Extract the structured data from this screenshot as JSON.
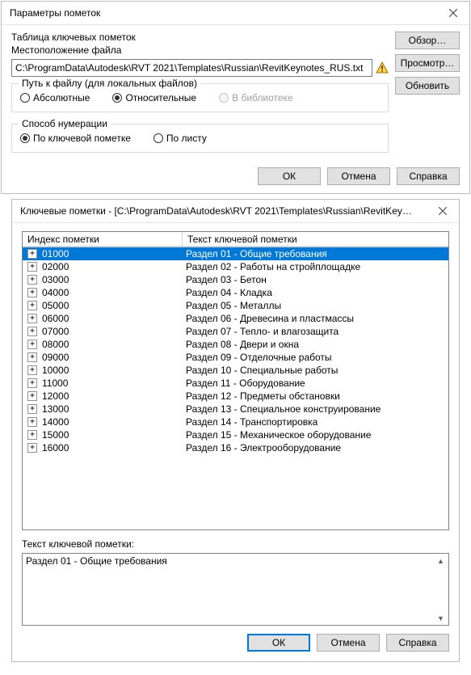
{
  "dialog1": {
    "title": "Параметры пометок",
    "table_label": "Таблица ключевых пометок",
    "file_loc_label": "Местоположение файла",
    "file_path": "C:\\ProgramData\\Autodesk\\RVT 2021\\Templates\\Russian\\RevitKeynotes_RUS.txt",
    "btn_browse": "Обзор…",
    "btn_view": "Просмотр…",
    "btn_update": "Обновить",
    "path_group_label": "Путь к файлу (для локальных файлов)",
    "radio_absolute": "Абсолютные",
    "radio_relative": "Относительные",
    "radio_library": "В библиотеке",
    "numbering_label": "Способ нумерации",
    "radio_by_key": "По ключевой пометке",
    "radio_by_sheet": "По листу",
    "btn_ok": "ОК",
    "btn_cancel": "Отмена",
    "btn_help": "Справка"
  },
  "dialog2": {
    "title": "Ключевые пометки - [C:\\ProgramData\\Autodesk\\RVT 2021\\Templates\\Russian\\RevitKeynote…",
    "col_index": "Индекс пометки",
    "col_text": "Текст ключевой пометки",
    "rows": [
      {
        "code": "01000",
        "text": "Раздел 01 - Общие требования",
        "selected": true
      },
      {
        "code": "02000",
        "text": "Раздел 02 - Работы на стройплощадке"
      },
      {
        "code": "03000",
        "text": "Раздел 03 - Бетон"
      },
      {
        "code": "04000",
        "text": "Раздел 04 - Кладка"
      },
      {
        "code": "05000",
        "text": "Раздел 05 - Металлы"
      },
      {
        "code": "06000",
        "text": "Раздел 06 - Древесина и пластмассы"
      },
      {
        "code": "07000",
        "text": "Раздел 07 - Тепло- и влагозащита"
      },
      {
        "code": "08000",
        "text": "Раздел 08 - Двери и окна"
      },
      {
        "code": "09000",
        "text": "Раздел 09 - Отделочные работы"
      },
      {
        "code": "10000",
        "text": "Раздел 10 - Специальные работы"
      },
      {
        "code": "11000",
        "text": "Раздел 11 - Оборудование"
      },
      {
        "code": "12000",
        "text": "Раздел 12 - Предметы обстановки"
      },
      {
        "code": "13000",
        "text": "Раздел 13 - Специальное конструирование"
      },
      {
        "code": "14000",
        "text": "Раздел 14 - Транспортировка"
      },
      {
        "code": "15000",
        "text": "Раздел 15 - Механическое оборудование"
      },
      {
        "code": "16000",
        "text": "Раздел 16 - Электрооборудование"
      }
    ],
    "detail_label": "Текст ключевой пометки:",
    "detail_text": "Раздел 01 - Общие требования",
    "btn_ok": "ОК",
    "btn_cancel": "Отмена",
    "btn_help": "Справка"
  }
}
